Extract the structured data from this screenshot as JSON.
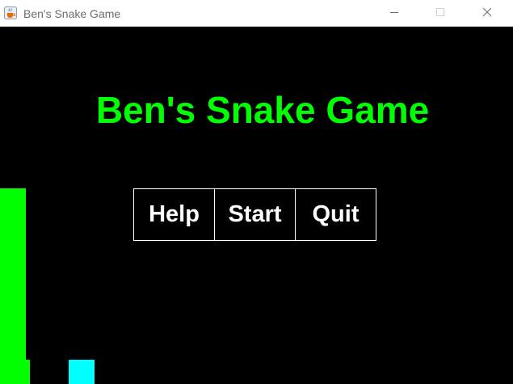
{
  "window": {
    "title": "Ben's Snake Game",
    "icon": "java-cup-icon",
    "controls": {
      "minimize": "minimize-icon",
      "maximize": "maximize-icon",
      "close": "close-icon"
    }
  },
  "game": {
    "title": "Ben's Snake Game",
    "menu": [
      {
        "label": "Help"
      },
      {
        "label": "Start"
      },
      {
        "label": "Quit"
      }
    ]
  },
  "colors": {
    "background": "#000000",
    "title": "#00ff00",
    "menu_text": "#ffffff",
    "menu_border": "#ffffff",
    "snake": "#00ff00",
    "food": "#00ffff"
  }
}
